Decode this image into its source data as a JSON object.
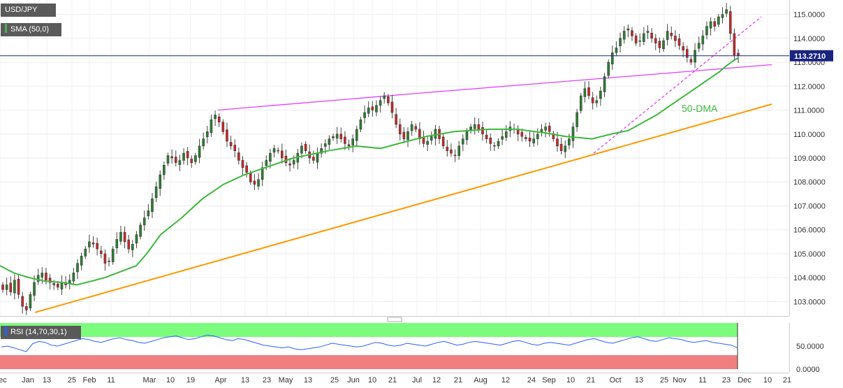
{
  "chart_data": {
    "type": "candlestick",
    "symbol": "USD/JPY",
    "legend": [
      {
        "label": "USD/JPY",
        "color": "#555555"
      },
      {
        "label": "SMA (50,0)",
        "color": "#4caf50"
      }
    ],
    "last_price": "113.2710",
    "y_ticks": [
      "115.0000",
      "114.0000",
      "113.0000",
      "112.0000",
      "111.0000",
      "110.0000",
      "109.0000",
      "108.0000",
      "107.0000",
      "106.0000",
      "105.0000",
      "104.0000",
      "103.0000"
    ],
    "x_ticks": [
      "Dec",
      "Jan",
      "13",
      "25",
      "Feb",
      "11",
      "Mar",
      "10",
      "19",
      "Apr",
      "13",
      "23",
      "May",
      "13",
      "25",
      "Jun",
      "10",
      "21",
      "Jul",
      "12",
      "21",
      "Aug",
      "12",
      "24",
      "Sep",
      "10",
      "21",
      "Oct",
      "13",
      "25",
      "Nov",
      "11",
      "23",
      "Dec",
      "10",
      "21"
    ],
    "ylim": [
      102.4,
      115.6
    ],
    "closes": [
      103.5,
      103.7,
      103.4,
      103.9,
      103.3,
      102.8,
      102.65,
      103.3,
      103.8,
      104.1,
      104.2,
      103.9,
      103.8,
      103.7,
      103.6,
      103.8,
      103.7,
      103.9,
      104.2,
      104.6,
      104.9,
      105.2,
      105.5,
      105.4,
      105.2,
      105.0,
      104.6,
      104.7,
      105.2,
      105.6,
      105.9,
      105.5,
      105.2,
      105.4,
      105.8,
      106.2,
      106.5,
      106.8,
      107.3,
      107.8,
      108.3,
      108.7,
      109.1,
      109.0,
      108.8,
      108.9,
      109.2,
      109.0,
      108.8,
      109.1,
      109.5,
      109.8,
      110.1,
      110.6,
      110.8,
      110.5,
      110.1,
      109.7,
      109.5,
      109.3,
      108.9,
      108.6,
      108.4,
      108.0,
      107.9,
      108.1,
      108.6,
      108.9,
      109.2,
      109.4,
      109.3,
      109.0,
      108.8,
      108.7,
      108.9,
      109.2,
      109.5,
      109.3,
      109.0,
      108.9,
      109.2,
      109.4,
      109.6,
      109.8,
      109.9,
      110.0,
      109.8,
      109.6,
      109.5,
      109.8,
      110.2,
      110.6,
      110.9,
      111.1,
      111.0,
      111.2,
      111.4,
      111.6,
      111.3,
      110.9,
      110.4,
      110.0,
      109.8,
      110.1,
      110.4,
      110.2,
      109.8,
      109.6,
      109.7,
      109.9,
      110.2,
      109.8,
      109.5,
      109.3,
      109.2,
      109.1,
      109.5,
      109.8,
      110.1,
      110.3,
      110.4,
      110.2,
      110.0,
      109.8,
      109.6,
      109.5,
      109.7,
      109.9,
      110.1,
      110.3,
      110.2,
      110.0,
      109.9,
      109.8,
      109.7,
      109.8,
      110.0,
      110.2,
      110.3,
      110.1,
      109.8,
      109.5,
      109.3,
      109.5,
      109.8,
      110.3,
      110.9,
      111.6,
      111.9,
      111.6,
      111.3,
      111.4,
      111.8,
      112.4,
      113.0,
      113.4,
      113.6,
      114.0,
      114.3,
      114.4,
      114.1,
      113.8,
      113.9,
      114.2,
      114.3,
      114.0,
      113.8,
      113.6,
      113.9,
      114.3,
      114.1,
      113.9,
      113.7,
      113.5,
      113.2,
      113.0,
      113.5,
      113.8,
      114.1,
      114.5,
      114.7,
      114.5,
      114.9,
      115.0,
      115.2,
      114.2,
      113.3,
      113.27
    ],
    "sma_50": [
      [
        0,
        104.5
      ],
      [
        20,
        104.2
      ],
      [
        42,
        104.0
      ],
      [
        65,
        103.85
      ],
      [
        90,
        103.8
      ],
      [
        110,
        103.7
      ],
      [
        150,
        104.0
      ],
      [
        195,
        104.5
      ],
      [
        210,
        105.0
      ],
      [
        230,
        105.8
      ],
      [
        260,
        106.5
      ],
      [
        290,
        107.3
      ],
      [
        320,
        107.9
      ],
      [
        350,
        108.3
      ],
      [
        380,
        108.6
      ],
      [
        420,
        109.0
      ],
      [
        470,
        109.3
      ],
      [
        510,
        109.5
      ],
      [
        545,
        109.4
      ],
      [
        570,
        109.6
      ],
      [
        610,
        109.9
      ],
      [
        650,
        110.1
      ],
      [
        700,
        110.2
      ],
      [
        740,
        110.2
      ],
      [
        780,
        110.05
      ],
      [
        810,
        109.9
      ],
      [
        848,
        109.8
      ],
      [
        875,
        110.0
      ],
      [
        900,
        110.15
      ],
      [
        940,
        110.8
      ],
      [
        970,
        111.4
      ],
      [
        1000,
        112.0
      ],
      [
        1030,
        112.6
      ],
      [
        1040,
        112.85
      ],
      [
        1052,
        113.1
      ],
      [
        1058,
        113.2
      ]
    ],
    "trendlines": [
      {
        "color": "#ff9800",
        "points": [
          [
            50,
            102.55
          ],
          [
            1105,
            111.25
          ]
        ]
      },
      {
        "color": "#e040fb",
        "points": [
          [
            312,
            111.0
          ],
          [
            598,
            111.7
          ],
          [
            1105,
            112.9
          ]
        ]
      },
      {
        "color": "#e040fb",
        "style": "dashed",
        "points": [
          [
            850,
            109.2
          ],
          [
            1090,
            114.9
          ]
        ]
      }
    ],
    "annotation": "50-DMA",
    "rsi": {
      "label": "RSI (14,70,30,1)",
      "y_ticks": [
        "50.0000",
        "0.0000"
      ],
      "overbought": 70,
      "oversold": 30,
      "values": [
        48,
        50,
        46,
        42,
        38,
        55,
        60,
        58,
        52,
        50,
        54,
        58,
        62,
        66,
        64,
        60,
        58,
        62,
        66,
        68,
        64,
        62,
        58,
        56,
        60,
        64,
        68,
        70,
        72,
        68,
        64,
        66,
        70,
        74,
        72,
        68,
        64,
        62,
        66,
        64,
        60,
        56,
        52,
        50,
        48,
        46,
        48,
        44,
        42,
        44,
        46,
        48,
        52,
        56,
        54,
        52,
        50,
        48,
        50,
        54,
        58,
        56,
        52,
        50,
        52,
        56,
        54,
        52,
        50,
        54,
        58,
        60,
        56,
        52,
        54,
        58,
        60,
        58,
        56,
        54,
        52,
        56,
        60,
        62,
        58,
        54,
        52,
        56,
        58,
        56,
        54,
        52,
        56,
        60,
        64,
        66,
        62,
        58,
        56,
        60,
        64,
        68,
        70,
        66,
        62,
        60,
        64,
        68,
        66,
        64,
        60,
        58,
        60,
        62,
        58,
        56,
        54,
        52,
        46
      ]
    }
  }
}
